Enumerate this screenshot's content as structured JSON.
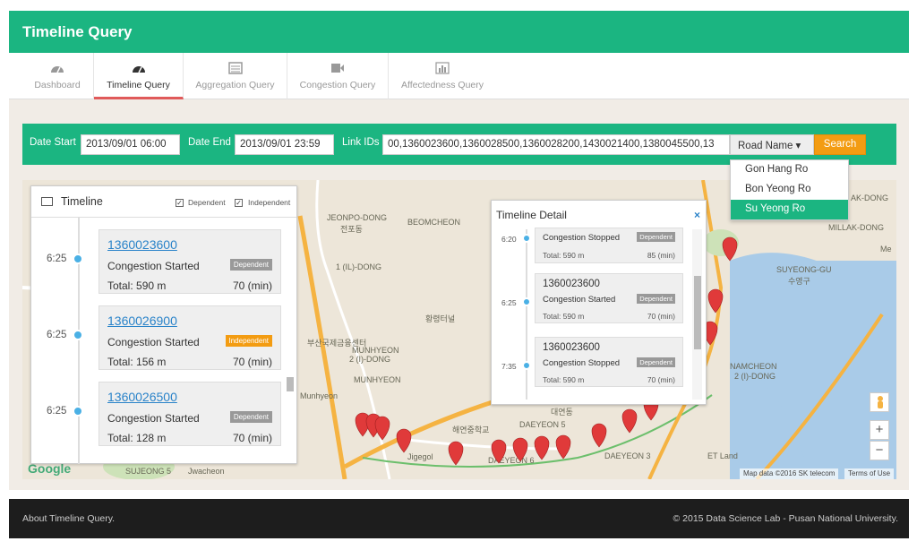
{
  "header": {
    "title": "Timeline Query"
  },
  "tabs": [
    {
      "label": "Dashboard",
      "icon": "dashboard-icon"
    },
    {
      "label": "Timeline Query",
      "icon": "dashboard-icon",
      "active": true
    },
    {
      "label": "Aggregation Query",
      "icon": "list-icon"
    },
    {
      "label": "Congestion Query",
      "icon": "video-icon"
    },
    {
      "label": "Affectedness Query",
      "icon": "bar-chart-icon"
    }
  ],
  "filter": {
    "date_start_label": "Date Start",
    "date_start_value": "2013/09/01 06:00",
    "date_end_label": "Date End",
    "date_end_value": "2013/09/01 23:59",
    "link_ids_label": "Link IDs",
    "link_ids_value": "00,1360023600,1360028500,1360028200,1430021400,1380045500,13",
    "road_name_button": "Road Name ▾",
    "search_button": "Search"
  },
  "road_dropdown": {
    "options": [
      "Gon Hang Ro",
      "Bon Yeong Ro",
      "Su Yeong Ro"
    ],
    "selected": "Su Yeong Ro"
  },
  "timeline": {
    "title": "Timeline",
    "dependent_label": "Dependent",
    "independent_label": "Independent",
    "entries": [
      {
        "time": "6:25",
        "id": "1360023600",
        "status": "Congestion Started",
        "badge": "Dependent",
        "total": "Total: 590 m",
        "minutes": "70 (min)"
      },
      {
        "time": "6:25",
        "id": "1360026900",
        "status": "Congestion Started",
        "badge": "Independent",
        "total": "Total: 156 m",
        "minutes": "70 (min)"
      },
      {
        "time": "6:25",
        "id": "1360026500",
        "status": "Congestion Started",
        "badge": "Dependent",
        "total": "Total: 128 m",
        "minutes": "70 (min)"
      }
    ]
  },
  "timeline_detail": {
    "title": "Timeline Detail",
    "close": "×",
    "entries": [
      {
        "time": "6:20",
        "id": "",
        "status": "Congestion Stopped",
        "badge": "Dependent",
        "total": "Total: 590 m",
        "minutes": "85 (min)"
      },
      {
        "time": "6:25",
        "id": "1360023600",
        "status": "Congestion Started",
        "badge": "Dependent",
        "total": "Total: 590 m",
        "minutes": "70 (min)"
      },
      {
        "time": "7:35",
        "id": "1360023600",
        "status": "Congestion Stopped",
        "badge": "Dependent",
        "total": "Total: 590 m",
        "minutes": "70 (min)"
      }
    ]
  },
  "map": {
    "labels": [
      {
        "text": "JEONPO-DONG"
      },
      {
        "text": "전포동"
      },
      {
        "text": "BEOMCHEON"
      },
      {
        "text": "1 (IL)-DONG"
      },
      {
        "text": "MUNHYEON"
      },
      {
        "text": "2 (I)-DONG"
      },
      {
        "text": "MUNHYEON"
      },
      {
        "text": "Munhyeon"
      },
      {
        "text": "Jigegol"
      },
      {
        "text": "DAEYEON 5"
      },
      {
        "text": "DAEYEON 6"
      },
      {
        "text": "DAEYEON 3"
      },
      {
        "text": "SUJEONG 5"
      },
      {
        "text": "Jwacheon"
      },
      {
        "text": "SUYEONG-GU"
      },
      {
        "text": "수영구"
      },
      {
        "text": "NAMCHEON"
      },
      {
        "text": "2 (I)-DONG"
      },
      {
        "text": "MILLAK-DONG"
      },
      {
        "text": "AK-DONG"
      },
      {
        "text": "ET Land"
      },
      {
        "text": "Me"
      },
      {
        "text": "부산국제금융센터"
      },
      {
        "text": "황령터널"
      },
      {
        "text": "대연동"
      },
      {
        "text": "해연중학교"
      }
    ],
    "google_logo": "Google",
    "map_data": "Map data ©2016 SK telecom",
    "terms": "Terms of Use",
    "zoom_in": "+",
    "zoom_out": "−"
  },
  "footer": {
    "left": "About Timeline Query.",
    "right": "© 2015 Data Science Lab - Pusan National University."
  },
  "colors": {
    "brand": "#1bb581",
    "search": "#f39c12",
    "dependent_badge": "#999999",
    "independent_badge": "#f39c12",
    "link": "#2a83c9",
    "active_tab": "#e05a5a",
    "marker": "#e03a3a"
  }
}
